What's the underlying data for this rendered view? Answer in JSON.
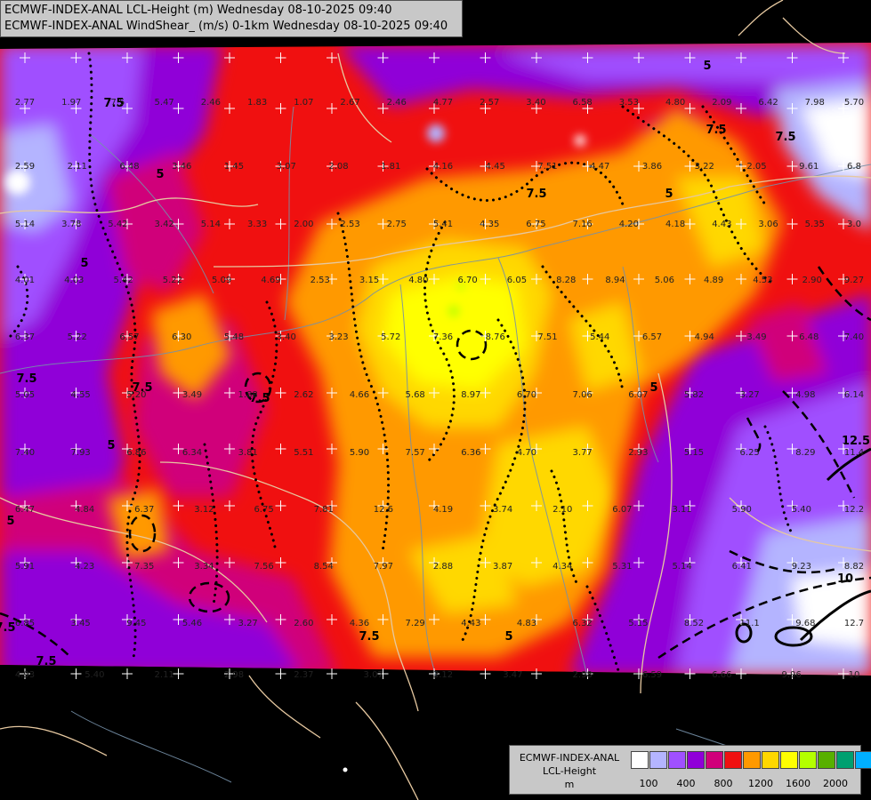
{
  "title": {
    "line1": "ECMWF-INDEX-ANAL LCL-Height (m) Wednesday 08-10-2025 09:40",
    "line2": "ECMWF-INDEX-ANAL WindShear_ (m/s) 0-1km Wednesday 08-10-2025 09:40"
  },
  "legend": {
    "model": "ECMWF-INDEX-ANAL",
    "field": "LCL-Height",
    "unit": "m",
    "colors": [
      "#ffffff",
      "#b4b4ff",
      "#a050ff",
      "#9000d8",
      "#d0007a",
      "#f01010",
      "#ff9900",
      "#ffd800",
      "#ffff00",
      "#b4ff00",
      "#58b000",
      "#00a070",
      "#00b0ff"
    ],
    "tick_labels": [
      "100",
      "400",
      "800",
      "1200",
      "1600",
      "2000"
    ]
  },
  "contour_labels": [
    "7.5",
    "5",
    "5",
    "7.5",
    "7.5",
    "5",
    "5",
    "7.5",
    "7.5",
    "7.5",
    "5",
    "5",
    "5",
    "12.5",
    "10",
    "7.5",
    "7.5",
    "7.5",
    "5",
    "7.5"
  ],
  "station_values": [
    "2.77",
    "1.97",
    "7.5",
    "5.47",
    "2.46",
    "1.83",
    "1.07",
    "2.67",
    "2.46",
    "4.77",
    "2.57",
    "3.40",
    "6.58",
    "3.53",
    "4.80",
    "2.09",
    "6.42",
    "7.98",
    "5.70",
    "2.59",
    "2.11",
    "6.48",
    "3.46",
    "1.45",
    "3.07",
    "2.08",
    "1.81",
    "4.16",
    "4.45",
    "7.51",
    "4.47",
    "3.86",
    "3.22",
    "2.05",
    "9.61",
    "6.8",
    "5.14",
    "3.78",
    "5.42",
    "3.42",
    "5.14",
    "3.33",
    "2.00",
    "2.53",
    "2.75",
    "5.41",
    "4.35",
    "6.75",
    "7.16",
    "4.20",
    "4.18",
    "4.43",
    "3.06",
    "5.35",
    "3.0",
    "4.01",
    "4.03",
    "5.42",
    "5.22",
    "5.09",
    "4.69",
    "2.53",
    "3.15",
    "4.80",
    "6.70",
    "6.05",
    "8.28",
    "8.94",
    "5.06",
    "4.89",
    "4.53",
    "2.90",
    "9.27",
    "6.37",
    "5.22",
    "6.57",
    "6.30",
    "5.48",
    "3.40",
    "3.23",
    "5.72",
    "7.36",
    "8.76",
    "7.51",
    "5.44",
    "6.57",
    "4.94",
    "3.49",
    "6.48",
    "7.40",
    "5.05",
    "4.55",
    "5.20",
    "3.49",
    "1.88",
    "2.62",
    "4.66",
    "5.68",
    "8.97",
    "6.70",
    "7.06",
    "6.07",
    "5.82",
    "3.27",
    "4.98",
    "6.14",
    "7.40",
    "7.93",
    "6.86",
    "6.34",
    "3.81",
    "5.51",
    "5.90",
    "7.57",
    "6.36",
    "4.70",
    "3.77",
    "2.93",
    "5.15",
    "6.25",
    "8.29",
    "11.4",
    "6.47",
    "4.84",
    "6.37",
    "3.12",
    "6.75",
    "7.81",
    "12.6",
    "4.19",
    "3.74",
    "2.10",
    "6.07",
    "3.11",
    "5.90",
    "5.40",
    "12.2",
    "5.91",
    "4.23",
    "7.35",
    "3.34",
    "7.56",
    "8.54",
    "7.97",
    "2.88",
    "3.87",
    "4.34",
    "5.31",
    "5.14",
    "6.41",
    "9.23",
    "8.82",
    "6.85",
    "3.45",
    "9.45",
    "5.46",
    "3.27",
    "2.60",
    "4.36",
    "7.29",
    "4.43",
    "4.83",
    "6.32",
    "5.15",
    "8.52",
    "11.1",
    "9.68",
    "12.7",
    "4.93",
    "5.40",
    "2.11",
    "2.98",
    "2.37",
    "3.07",
    "3.12",
    "3.47",
    "2.98",
    "6.59",
    "6.66",
    "9.96",
    "10"
  ]
}
